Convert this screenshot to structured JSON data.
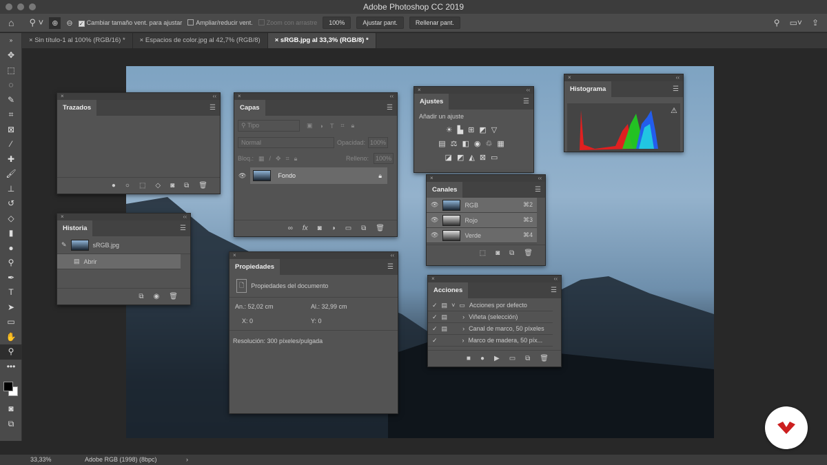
{
  "window": {
    "title": "Adobe Photoshop CC 2019"
  },
  "options": {
    "resize_windows": "Cambiar tamaño vent. para ajustar",
    "zoom_all": "Ampliar/reducir vent.",
    "scrubby": "Zoom con arrastre",
    "zoom_value": "100%",
    "fit": "Ajustar pant.",
    "fill": "Rellenar pant."
  },
  "tabs": [
    {
      "label": "Sin título-1 al 100% (RGB/16) *"
    },
    {
      "label": "Espacios de color.jpg al 42,7% (RGB/8)"
    },
    {
      "label": "sRGB.jpg al 33,3% (RGB/8) *"
    }
  ],
  "trazados": {
    "title": "Trazados"
  },
  "historia": {
    "title": "Historia",
    "snapshot": "sRGB.jpg",
    "items": [
      "Abrir"
    ]
  },
  "capas": {
    "title": "Capas",
    "filter": "Tipo",
    "blend": "Normal",
    "opacity_label": "Opacidad:",
    "opacity": "100%",
    "lock_label": "Bloq.:",
    "fill_label": "Relleno:",
    "fill": "100%",
    "layers": [
      {
        "name": "Fondo"
      }
    ]
  },
  "ajustes": {
    "title": "Ajustes",
    "subtitle": "Añadir un ajuste"
  },
  "histograma": {
    "title": "Histograma"
  },
  "canales": {
    "title": "Canales",
    "channels": [
      {
        "name": "RGB",
        "shortcut": "⌘2"
      },
      {
        "name": "Rojo",
        "shortcut": "⌘3"
      },
      {
        "name": "Verde",
        "shortcut": "⌘4"
      }
    ]
  },
  "acciones": {
    "title": "Acciones",
    "items": [
      "Acciones por defecto",
      "Viñeta (selección)",
      "Canal de marco, 50 píxeles",
      "Marco de madera, 50 píx..."
    ]
  },
  "propiedades": {
    "title": "Propiedades",
    "doc": "Propiedades del documento",
    "width": "An.: 52,02 cm",
    "height": "Al.: 32,99 cm",
    "x": "X: 0",
    "y": "Y: 0",
    "resolution": "Resolución: 300 píxeles/pulgada"
  },
  "status": {
    "zoom": "33,33%",
    "profile": "Adobe RGB (1998) (8bpc)"
  },
  "colors": {
    "accent": "#cc1f1f",
    "panel": "#535353"
  }
}
